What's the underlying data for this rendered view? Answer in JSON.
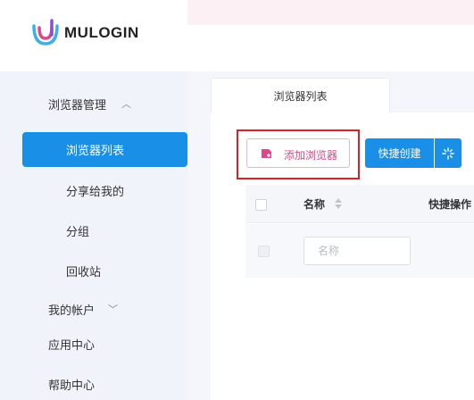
{
  "app": {
    "logo_text": "MULOGIN"
  },
  "sidebar": {
    "group_browser": "浏览器管理",
    "items": [
      {
        "label": "浏览器列表",
        "active": true
      },
      {
        "label": "分享给我的"
      },
      {
        "label": "分组"
      },
      {
        "label": "回收站"
      }
    ],
    "my_account": "我的帐户",
    "app_center": "应用中心",
    "help_center": "帮助中心"
  },
  "tabs": [
    {
      "label": "浏览器列表"
    }
  ],
  "toolbar": {
    "add_browser_label": "添加浏览器",
    "quick_create_label": "快捷创建"
  },
  "table": {
    "columns": [
      "名称",
      "快捷操作"
    ],
    "filter_placeholder": "名称"
  },
  "colors": {
    "primary": "#1a8fe8",
    "accent_pink": "#e0468a",
    "highlight_red": "#e02020"
  }
}
